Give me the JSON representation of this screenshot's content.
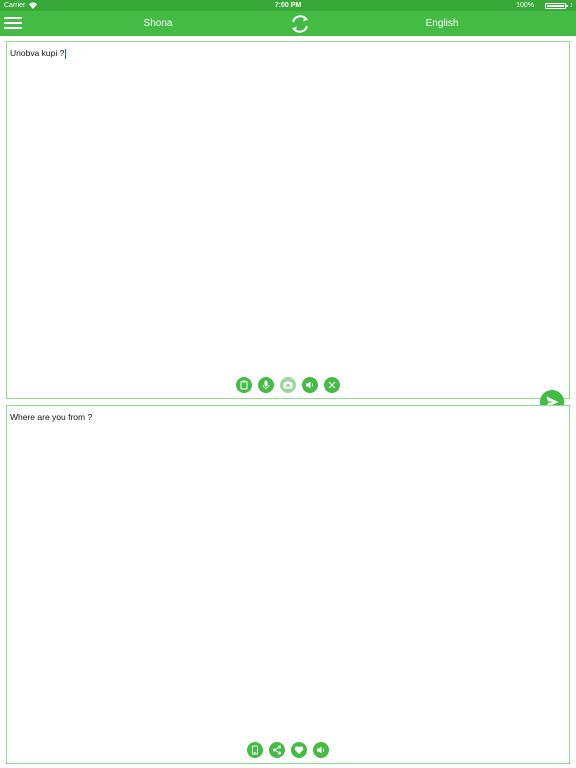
{
  "status_bar": {
    "carrier": "Carrier",
    "time": "7:00 PM",
    "battery": "100%"
  },
  "nav": {
    "source_language": "Shona",
    "target_language": "English"
  },
  "source_panel": {
    "text": "Unobva kupi ?",
    "tools": [
      "clipboard-icon",
      "microphone-icon",
      "camera-icon",
      "speaker-icon",
      "clear-icon"
    ]
  },
  "target_panel": {
    "text": "Where are you from ?",
    "tools": [
      "copy-icon",
      "share-icon",
      "favorite-icon",
      "speaker-icon"
    ]
  },
  "colors": {
    "primary": "#44bb44",
    "status_bar": "#38a838",
    "panel_border": "#8fdc8f",
    "disabled": "#9ed89e"
  }
}
